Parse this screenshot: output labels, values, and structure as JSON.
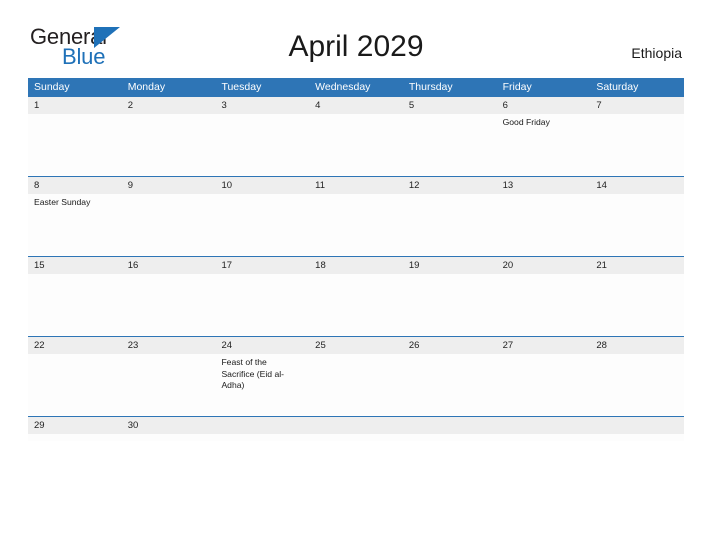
{
  "brand": {
    "name_part1": "General",
    "name_part2": "Blue",
    "triangle_icon": "triangle-icon",
    "accent_color": "#1f71b8"
  },
  "header": {
    "title": "April 2029",
    "country": "Ethiopia"
  },
  "calendar": {
    "header_bg": "#2e75b6",
    "date_band_bg": "#eeeeee",
    "weekdays": [
      "Sunday",
      "Monday",
      "Tuesday",
      "Wednesday",
      "Thursday",
      "Friday",
      "Saturday"
    ],
    "weeks": [
      {
        "days": [
          {
            "date": "1",
            "events": ""
          },
          {
            "date": "2",
            "events": ""
          },
          {
            "date": "3",
            "events": ""
          },
          {
            "date": "4",
            "events": ""
          },
          {
            "date": "5",
            "events": ""
          },
          {
            "date": "6",
            "events": "Good Friday"
          },
          {
            "date": "7",
            "events": ""
          }
        ]
      },
      {
        "days": [
          {
            "date": "8",
            "events": "Easter Sunday"
          },
          {
            "date": "9",
            "events": ""
          },
          {
            "date": "10",
            "events": ""
          },
          {
            "date": "11",
            "events": ""
          },
          {
            "date": "12",
            "events": ""
          },
          {
            "date": "13",
            "events": ""
          },
          {
            "date": "14",
            "events": ""
          }
        ]
      },
      {
        "days": [
          {
            "date": "15",
            "events": ""
          },
          {
            "date": "16",
            "events": ""
          },
          {
            "date": "17",
            "events": ""
          },
          {
            "date": "18",
            "events": ""
          },
          {
            "date": "19",
            "events": ""
          },
          {
            "date": "20",
            "events": ""
          },
          {
            "date": "21",
            "events": ""
          }
        ]
      },
      {
        "days": [
          {
            "date": "22",
            "events": ""
          },
          {
            "date": "23",
            "events": ""
          },
          {
            "date": "24",
            "events": "Feast of the Sacrifice (Eid al-Adha)"
          },
          {
            "date": "25",
            "events": ""
          },
          {
            "date": "26",
            "events": ""
          },
          {
            "date": "27",
            "events": ""
          },
          {
            "date": "28",
            "events": ""
          }
        ]
      },
      {
        "days": [
          {
            "date": "29",
            "events": ""
          },
          {
            "date": "30",
            "events": ""
          },
          {
            "date": "",
            "events": ""
          },
          {
            "date": "",
            "events": ""
          },
          {
            "date": "",
            "events": ""
          },
          {
            "date": "",
            "events": ""
          },
          {
            "date": "",
            "events": ""
          }
        ]
      }
    ]
  }
}
